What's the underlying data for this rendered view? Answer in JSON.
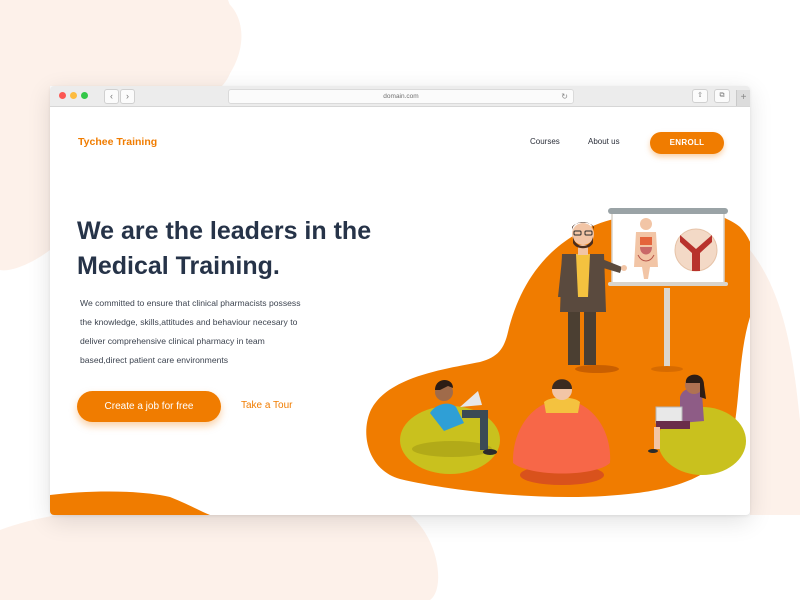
{
  "browser": {
    "url": "domain.com",
    "back_icon": "‹",
    "forward_icon": "›",
    "reload_icon": "↻",
    "share_icon": "⇧",
    "tabs_icon": "⧉",
    "new_tab_icon": "+"
  },
  "header": {
    "logo": "Tychee Training",
    "nav": [
      "Courses",
      "About us"
    ],
    "enroll_label": "ENROLL"
  },
  "hero": {
    "title_line1": "We are the leaders in the",
    "title_line2": "Medical Training.",
    "description_lines": [
      "We committed to ensure that clinical pharmacists possess",
      "the knowledge, skills,attitudes and behaviour necesary to",
      "deliver comprehensive clinical pharmacy in team",
      "based,direct patient care environments"
    ],
    "cta_label": "Create a job for free",
    "tour_label": "Take a Tour"
  },
  "colors": {
    "accent": "#f07c00",
    "heading": "#263348",
    "blob_light": "#fdf1ea",
    "beanbag_olive": "#c9c11e",
    "beanbag_red": "#f76748"
  }
}
